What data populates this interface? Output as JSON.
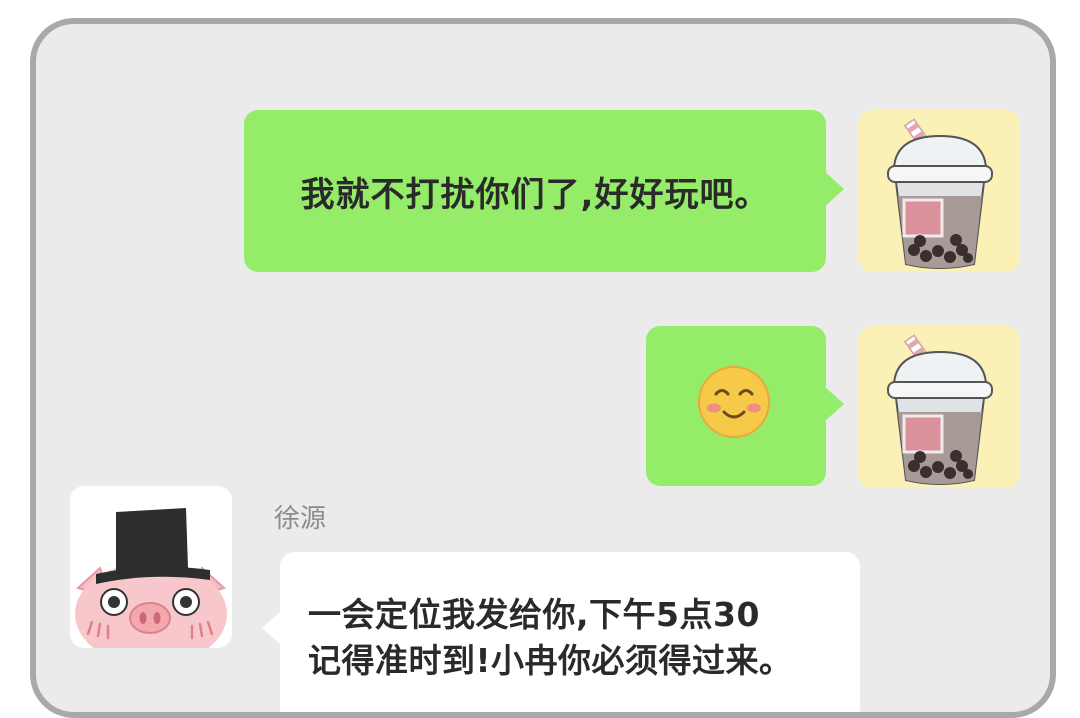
{
  "messages": [
    {
      "side": "right",
      "type": "text",
      "text": "我就不打扰你们了,好好玩吧。",
      "avatar": "bubble-tea-icon"
    },
    {
      "side": "right",
      "type": "emoji",
      "emoji": "smiling-face-blush-icon",
      "avatar": "bubble-tea-icon"
    },
    {
      "side": "left",
      "type": "text",
      "sender": "徐源",
      "line1": "一会定位我发给你,下午5点30",
      "line2": "记得准时到!小冉你必须得过来。",
      "avatar": "pig-top-hat-icon"
    }
  ],
  "colors": {
    "background": "#ebebeb",
    "frame_border": "#a9a9a9",
    "outgoing_bubble": "#95ec69",
    "incoming_bubble": "#ffffff",
    "tea_avatar_bg": "#fbf1b7",
    "sender_name": "#8c8c8c"
  }
}
